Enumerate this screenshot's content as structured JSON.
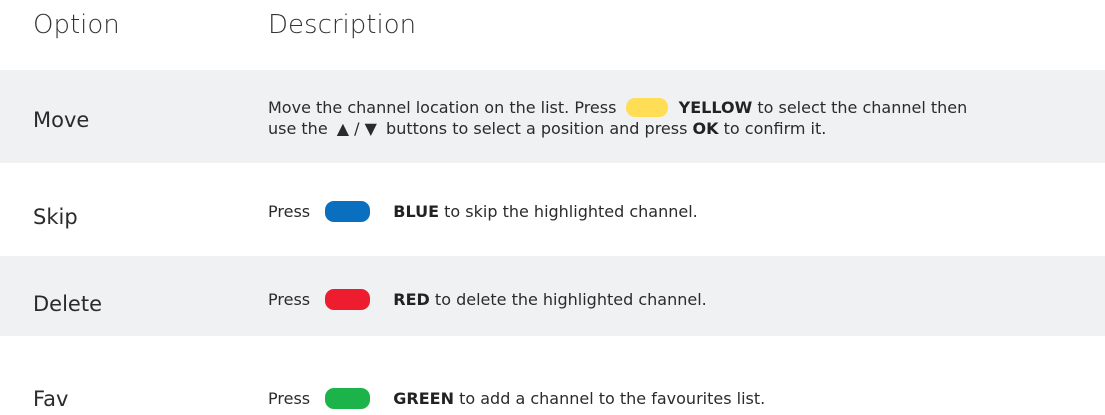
{
  "header": {
    "option": "Option",
    "description": "Description"
  },
  "rows": [
    {
      "option": "Move",
      "line1_pre": "Move the channel location on the list. Press",
      "key": "YELLOW",
      "line1_post": "to select the channel then",
      "line2_pre": "use the",
      "arrows": "▲ / ▼",
      "line2_mid": "buttons to select a position and press",
      "ok": "OK",
      "line2_post": "to confirm it.",
      "color": "#ffdd55"
    },
    {
      "option": "Skip",
      "press": "Press",
      "key": "BLUE",
      "text": "to skip the highlighted channel.",
      "color": "#0a6fbf"
    },
    {
      "option": "Delete",
      "press": "Press",
      "key": "RED",
      "text": "to delete the highlighted channel.",
      "color": "#ed1c2e"
    },
    {
      "option": "Fav",
      "press": "Press",
      "key": "GREEN",
      "text": "to add a channel to the favourites list.",
      "color": "#1db34b"
    }
  ]
}
